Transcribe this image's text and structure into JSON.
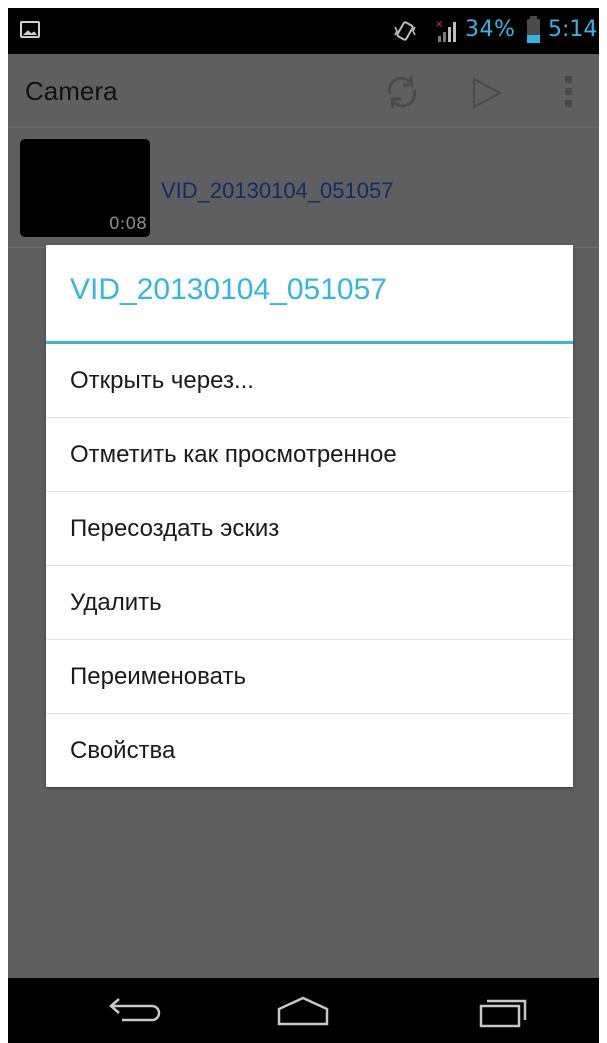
{
  "status_bar": {
    "battery_percent": "34%",
    "battery_level": 0.34,
    "time": "5:14",
    "icons": [
      "gallery-notification-icon",
      "vibrate-icon",
      "no-signal-icon",
      "battery-icon"
    ],
    "accent_color": "#33b5e5"
  },
  "action_bar": {
    "title": "Camera",
    "icons": [
      "refresh-icon",
      "play-icon",
      "overflow-menu-icon"
    ]
  },
  "list": {
    "items": [
      {
        "title": "VID_20130104_051057",
        "duration": "0:08"
      }
    ]
  },
  "dialog": {
    "title": "VID_20130104_051057",
    "options": [
      "Открыть через...",
      "Отметить как просмотренное",
      "Пересоздать эскиз",
      "Удалить",
      "Переименовать",
      "Свойства"
    ]
  },
  "nav_bar": {
    "icons": [
      "back-icon",
      "home-icon",
      "recent-apps-icon"
    ]
  }
}
